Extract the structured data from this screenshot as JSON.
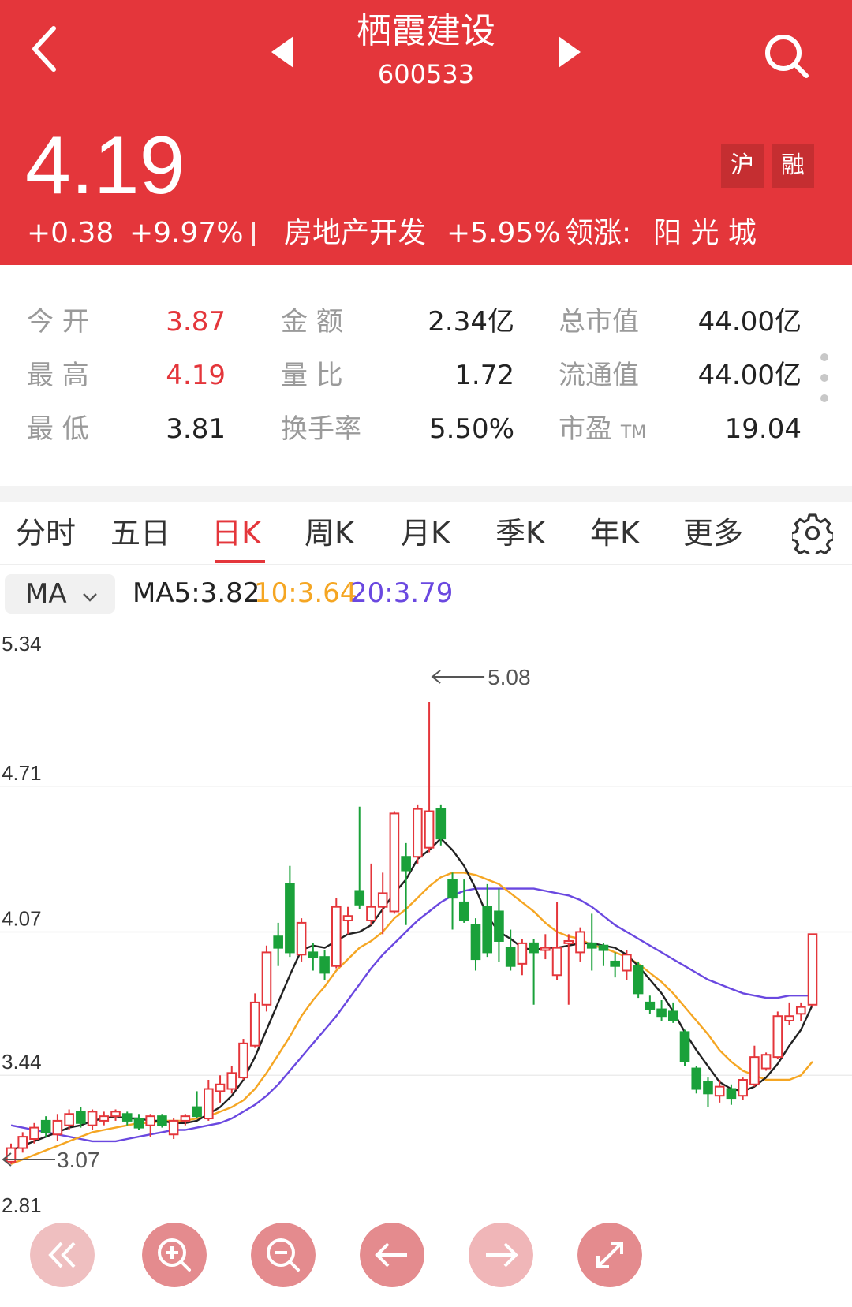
{
  "header": {
    "stock_name": "栖霞建设",
    "stock_code": "600533",
    "price": "4.19",
    "change": "+0.38",
    "change_pct": "+9.97%",
    "sector": "房地产开发",
    "sector_pct": "+5.95%",
    "leader_label": "领涨:",
    "leader_name": "阳 光 城",
    "badge_sh": "沪",
    "badge_rong": "融"
  },
  "quote": {
    "open_label": "今  开",
    "open": "3.87",
    "high_label": "最  高",
    "high": "4.19",
    "low_label": "最  低",
    "low": "3.81",
    "amount_label": "金  额",
    "amount": "2.34亿",
    "vol_ratio_label": "量  比",
    "vol_ratio": "1.72",
    "turnover_label": "换手率",
    "turnover": "5.50%",
    "mktcap_label": "总市值",
    "mktcap": "44.00亿",
    "float_label": "流通值",
    "float_cap": "44.00亿",
    "pe_label": "市盈",
    "pe_sub": "TM",
    "pe": "19.04"
  },
  "tabs": [
    "分时",
    "五日",
    "日K",
    "周K",
    "月K",
    "季K",
    "年K",
    "更多"
  ],
  "active_tab": 2,
  "ma": {
    "selector": "MA",
    "ma5": "MA5:3.82",
    "ma10": "10:3.64",
    "ma20": "20:3.79"
  },
  "colors": {
    "up": "#e4363b",
    "down": "#1aa13a",
    "ma5": "#222222",
    "ma10": "#f5a623",
    "ma20": "#6a48e0"
  },
  "chart_data": {
    "type": "candlestick",
    "y_ticks": [
      "5.34",
      "4.71",
      "4.07",
      "3.44",
      "2.81"
    ],
    "ylim": [
      2.81,
      5.34
    ],
    "max_marker": "5.08",
    "min_marker": "3.07",
    "candles": [
      {
        "o": 3.06,
        "c": 3.12,
        "h": 3.14,
        "l": 3.05
      },
      {
        "o": 3.12,
        "c": 3.17,
        "h": 3.19,
        "l": 3.1
      },
      {
        "o": 3.16,
        "c": 3.21,
        "h": 3.23,
        "l": 3.14
      },
      {
        "o": 3.24,
        "c": 3.19,
        "h": 3.26,
        "l": 3.17
      },
      {
        "o": 3.18,
        "c": 3.24,
        "h": 3.27,
        "l": 3.15
      },
      {
        "o": 3.22,
        "c": 3.27,
        "h": 3.29,
        "l": 3.2
      },
      {
        "o": 3.28,
        "c": 3.23,
        "h": 3.3,
        "l": 3.21
      },
      {
        "o": 3.22,
        "c": 3.28,
        "h": 3.29,
        "l": 3.2
      },
      {
        "o": 3.24,
        "c": 3.26,
        "h": 3.28,
        "l": 3.22
      },
      {
        "o": 3.26,
        "c": 3.28,
        "h": 3.29,
        "l": 3.24
      },
      {
        "o": 3.27,
        "c": 3.24,
        "h": 3.28,
        "l": 3.22
      },
      {
        "o": 3.25,
        "c": 3.21,
        "h": 3.27,
        "l": 3.2
      },
      {
        "o": 3.22,
        "c": 3.26,
        "h": 3.27,
        "l": 3.17
      },
      {
        "o": 3.26,
        "c": 3.22,
        "h": 3.27,
        "l": 3.21
      },
      {
        "o": 3.18,
        "c": 3.24,
        "h": 3.25,
        "l": 3.16
      },
      {
        "o": 3.24,
        "c": 3.26,
        "h": 3.27,
        "l": 3.22
      },
      {
        "o": 3.3,
        "c": 3.26,
        "h": 3.37,
        "l": 3.25
      },
      {
        "o": 3.25,
        "c": 3.38,
        "h": 3.42,
        "l": 3.24
      },
      {
        "o": 3.37,
        "c": 3.4,
        "h": 3.44,
        "l": 3.32
      },
      {
        "o": 3.38,
        "c": 3.45,
        "h": 3.48,
        "l": 3.36
      },
      {
        "o": 3.43,
        "c": 3.58,
        "h": 3.6,
        "l": 3.42
      },
      {
        "o": 3.57,
        "c": 3.76,
        "h": 3.8,
        "l": 3.56
      },
      {
        "o": 3.75,
        "c": 3.98,
        "h": 4.01,
        "l": 3.72
      },
      {
        "o": 4.05,
        "c": 4.0,
        "h": 4.11,
        "l": 3.92
      },
      {
        "o": 4.28,
        "c": 3.98,
        "h": 4.36,
        "l": 3.96
      },
      {
        "o": 3.97,
        "c": 4.11,
        "h": 4.13,
        "l": 3.94
      },
      {
        "o": 3.98,
        "c": 3.96,
        "h": 4.02,
        "l": 3.9
      },
      {
        "o": 3.96,
        "c": 3.89,
        "h": 3.99,
        "l": 3.86
      },
      {
        "o": 3.92,
        "c": 4.18,
        "h": 4.22,
        "l": 3.91
      },
      {
        "o": 4.12,
        "c": 4.14,
        "h": 4.18,
        "l": 4.06
      },
      {
        "o": 4.25,
        "c": 4.19,
        "h": 4.62,
        "l": 4.17
      },
      {
        "o": 4.12,
        "c": 4.18,
        "h": 4.37,
        "l": 4.1
      },
      {
        "o": 4.18,
        "c": 4.24,
        "h": 4.33,
        "l": 4.06
      },
      {
        "o": 4.16,
        "c": 4.59,
        "h": 4.6,
        "l": 4.15
      },
      {
        "o": 4.4,
        "c": 4.34,
        "h": 4.46,
        "l": 4.1
      },
      {
        "o": 4.4,
        "c": 4.61,
        "h": 4.63,
        "l": 4.37
      },
      {
        "o": 4.44,
        "c": 4.6,
        "h": 5.08,
        "l": 4.42
      },
      {
        "o": 4.61,
        "c": 4.48,
        "h": 4.63,
        "l": 4.45
      },
      {
        "o": 4.3,
        "c": 4.22,
        "h": 4.33,
        "l": 4.08
      },
      {
        "o": 4.2,
        "c": 4.12,
        "h": 4.3,
        "l": 4.11
      },
      {
        "o": 4.1,
        "c": 3.95,
        "h": 4.13,
        "l": 3.9
      },
      {
        "o": 4.18,
        "c": 3.98,
        "h": 4.28,
        "l": 3.96
      },
      {
        "o": 4.16,
        "c": 4.03,
        "h": 4.26,
        "l": 3.94
      },
      {
        "o": 4.0,
        "c": 3.92,
        "h": 4.08,
        "l": 3.9
      },
      {
        "o": 3.93,
        "c": 4.02,
        "h": 4.04,
        "l": 3.88
      },
      {
        "o": 4.02,
        "c": 3.98,
        "h": 4.04,
        "l": 3.75
      },
      {
        "o": 3.99,
        "c": 4.0,
        "h": 4.06,
        "l": 3.95
      },
      {
        "o": 3.88,
        "c": 4.0,
        "h": 4.2,
        "l": 3.86
      },
      {
        "o": 4.02,
        "c": 4.03,
        "h": 4.06,
        "l": 3.75
      },
      {
        "o": 3.98,
        "c": 4.07,
        "h": 4.09,
        "l": 3.94
      },
      {
        "o": 4.02,
        "c": 4.0,
        "h": 4.15,
        "l": 3.9
      },
      {
        "o": 4.01,
        "c": 3.99,
        "h": 4.02,
        "l": 3.92
      },
      {
        "o": 3.94,
        "c": 3.92,
        "h": 3.98,
        "l": 3.87
      },
      {
        "o": 3.9,
        "c": 3.97,
        "h": 3.99,
        "l": 3.86
      },
      {
        "o": 3.92,
        "c": 3.8,
        "h": 3.94,
        "l": 3.78
      },
      {
        "o": 3.76,
        "c": 3.73,
        "h": 3.79,
        "l": 3.71
      },
      {
        "o": 3.73,
        "c": 3.7,
        "h": 3.77,
        "l": 3.68
      },
      {
        "o": 3.72,
        "c": 3.68,
        "h": 3.76,
        "l": 3.67
      },
      {
        "o": 3.63,
        "c": 3.5,
        "h": 3.64,
        "l": 3.48
      },
      {
        "o": 3.47,
        "c": 3.38,
        "h": 3.48,
        "l": 3.36
      },
      {
        "o": 3.41,
        "c": 3.36,
        "h": 3.43,
        "l": 3.3
      },
      {
        "o": 3.35,
        "c": 3.39,
        "h": 3.42,
        "l": 3.32
      },
      {
        "o": 3.38,
        "c": 3.34,
        "h": 3.4,
        "l": 3.31
      },
      {
        "o": 3.35,
        "c": 3.42,
        "h": 3.43,
        "l": 3.33
      },
      {
        "o": 3.4,
        "c": 3.52,
        "h": 3.57,
        "l": 3.39
      },
      {
        "o": 3.47,
        "c": 3.53,
        "h": 3.54,
        "l": 3.46
      },
      {
        "o": 3.52,
        "c": 3.7,
        "h": 3.72,
        "l": 3.51
      },
      {
        "o": 3.68,
        "c": 3.7,
        "h": 3.76,
        "l": 3.66
      },
      {
        "o": 3.71,
        "c": 3.74,
        "h": 3.76,
        "l": 3.68
      },
      {
        "o": 3.75,
        "c": 4.06,
        "h": 4.06,
        "l": 3.74
      }
    ],
    "ma5": [
      3.11,
      3.13,
      3.15,
      3.17,
      3.19,
      3.21,
      3.22,
      3.24,
      3.25,
      3.26,
      3.25,
      3.25,
      3.24,
      3.24,
      3.23,
      3.23,
      3.24,
      3.27,
      3.3,
      3.35,
      3.42,
      3.52,
      3.64,
      3.76,
      3.88,
      3.99,
      4.01,
      4.0,
      4.03,
      4.06,
      4.07,
      4.1,
      4.17,
      4.24,
      4.3,
      4.39,
      4.43,
      4.48,
      4.43,
      4.36,
      4.26,
      4.14,
      4.07,
      4.04,
      4.0,
      3.99,
      4.0,
      4.0,
      4.01,
      4.02,
      4.02,
      4.01,
      4.0,
      3.97,
      3.92,
      3.86,
      3.8,
      3.72,
      3.63,
      3.55,
      3.48,
      3.41,
      3.38,
      3.37,
      3.39,
      3.43,
      3.49,
      3.57,
      3.64,
      3.75
    ],
    "ma10": [
      3.05,
      3.07,
      3.09,
      3.11,
      3.13,
      3.15,
      3.17,
      3.19,
      3.2,
      3.21,
      3.22,
      3.23,
      3.23,
      3.24,
      3.24,
      3.24,
      3.25,
      3.26,
      3.28,
      3.3,
      3.33,
      3.38,
      3.45,
      3.53,
      3.61,
      3.7,
      3.77,
      3.83,
      3.9,
      3.95,
      4.0,
      4.03,
      4.07,
      4.13,
      4.17,
      4.22,
      4.27,
      4.31,
      4.33,
      4.33,
      4.32,
      4.3,
      4.28,
      4.24,
      4.2,
      4.16,
      4.11,
      4.07,
      4.05,
      4.04,
      4.01,
      4.0,
      3.98,
      3.96,
      3.93,
      3.89,
      3.85,
      3.8,
      3.74,
      3.68,
      3.62,
      3.55,
      3.5,
      3.46,
      3.44,
      3.42,
      3.42,
      3.42,
      3.44,
      3.5
    ],
    "ma20": [
      3.22,
      3.21,
      3.2,
      3.19,
      3.18,
      3.17,
      3.16,
      3.15,
      3.15,
      3.15,
      3.16,
      3.17,
      3.18,
      3.19,
      3.2,
      3.2,
      3.21,
      3.22,
      3.23,
      3.25,
      3.28,
      3.31,
      3.35,
      3.4,
      3.46,
      3.52,
      3.58,
      3.64,
      3.7,
      3.77,
      3.84,
      3.91,
      3.97,
      4.02,
      4.07,
      4.12,
      4.16,
      4.2,
      4.23,
      4.25,
      4.26,
      4.26,
      4.26,
      4.26,
      4.26,
      4.26,
      4.25,
      4.24,
      4.23,
      4.21,
      4.18,
      4.14,
      4.1,
      4.07,
      4.04,
      4.01,
      3.98,
      3.95,
      3.92,
      3.89,
      3.86,
      3.84,
      3.82,
      3.8,
      3.79,
      3.78,
      3.78,
      3.79,
      3.79,
      3.79
    ]
  }
}
